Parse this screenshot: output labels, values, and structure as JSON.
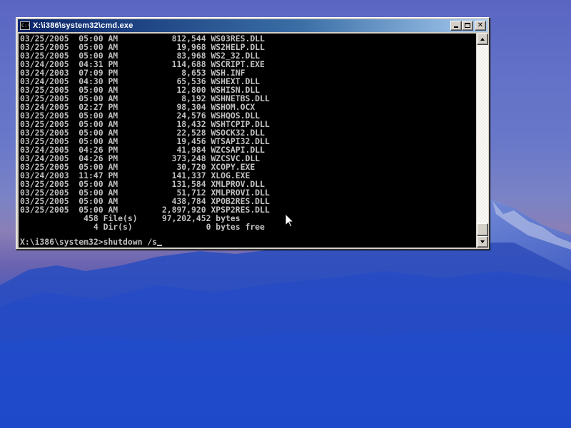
{
  "window": {
    "title": "X:\\i386\\system32\\cmd.exe",
    "icon_text": "C:\\"
  },
  "console": {
    "lines": [
      "03/25/2005  05:00 AM           812,544 WS03RES.DLL",
      "03/25/2005  05:00 AM            19,968 WS2HELP.DLL",
      "03/25/2005  05:00 AM            83,968 WS2_32.DLL",
      "03/24/2005  04:31 PM           114,688 WSCRIPT.EXE",
      "03/24/2003  07:09 PM             8,653 WSH.INF",
      "03/24/2005  04:30 PM            65,536 WSHEXT.DLL",
      "03/25/2005  05:00 AM            12,800 WSHISN.DLL",
      "03/25/2005  05:00 AM             8,192 WSHNETBS.DLL",
      "03/24/2005  02:27 PM            98,304 WSHOM.OCX",
      "03/25/2005  05:00 AM            24,576 WSHQOS.DLL",
      "03/25/2005  05:00 AM            18,432 WSHTCPIP.DLL",
      "03/25/2005  05:00 AM            22,528 WSOCK32.DLL",
      "03/25/2005  05:00 AM            19,456 WTSAPI32.DLL",
      "03/24/2005  04:26 PM            41,984 WZCSAPI.DLL",
      "03/24/2005  04:26 PM           373,248 WZCSVC.DLL",
      "03/25/2005  05:00 AM            30,720 XCOPY.EXE",
      "03/24/2003  11:47 PM           141,337 XLOG.EXE",
      "03/25/2005  05:00 AM           131,584 XMLPROV.DLL",
      "03/25/2005  05:00 AM            51,712 XMLPROVI.DLL",
      "03/25/2005  05:00 AM           438,784 XPOB2RES.DLL",
      "03/25/2005  05:00 AM         2,897,920 XPSP2RES.DLL",
      "             458 File(s)     97,202,452 bytes",
      "               4 Dir(s)               0 bytes free"
    ],
    "prompt": "X:\\i386\\system32>",
    "command": "shutdown /s"
  }
}
